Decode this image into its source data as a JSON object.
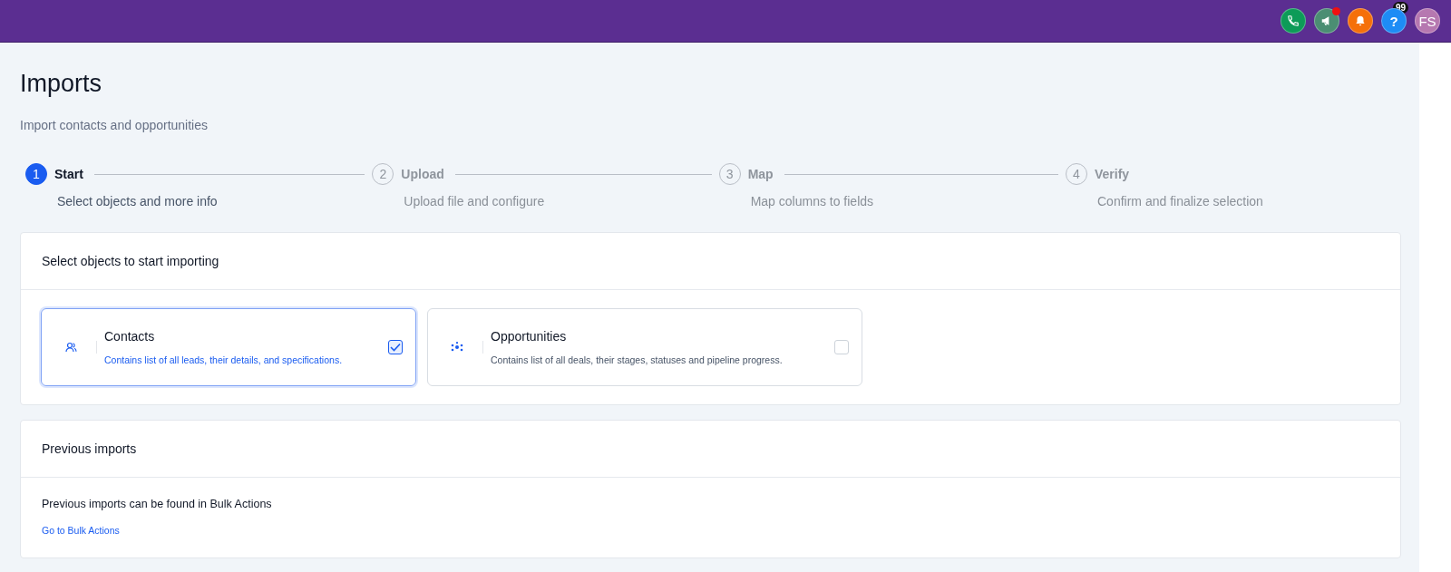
{
  "topbar": {
    "notification_count": "99",
    "avatar_initials": "FS",
    "help_label": "?",
    "announcement_unread": true
  },
  "page": {
    "title": "Imports",
    "subtitle": "Import contacts and opportunities"
  },
  "steps": [
    {
      "number": "1",
      "label": "Start",
      "description": "Select objects and more info",
      "selected": true
    },
    {
      "number": "2",
      "label": "Upload",
      "description": "Upload file and configure",
      "selected": false
    },
    {
      "number": "3",
      "label": "Map",
      "description": "Map columns to fields",
      "selected": false
    },
    {
      "number": "4",
      "label": "Verify",
      "description": "Confirm and finalize selection",
      "selected": false
    }
  ],
  "select_section": {
    "title": "Select objects to start importing",
    "objects": [
      {
        "kind": "contacts",
        "name": "Contacts",
        "description": "Contains list of all leads, their details, and specifications.",
        "checked": true
      },
      {
        "kind": "opportunities",
        "name": "Opportunities",
        "description": "Contains list of all deals, their stages, statuses and pipeline progress.",
        "checked": false
      }
    ]
  },
  "previous_section": {
    "title": "Previous imports",
    "text": "Previous imports can be found in Bulk Actions",
    "link": "Go to Bulk Actions"
  }
}
